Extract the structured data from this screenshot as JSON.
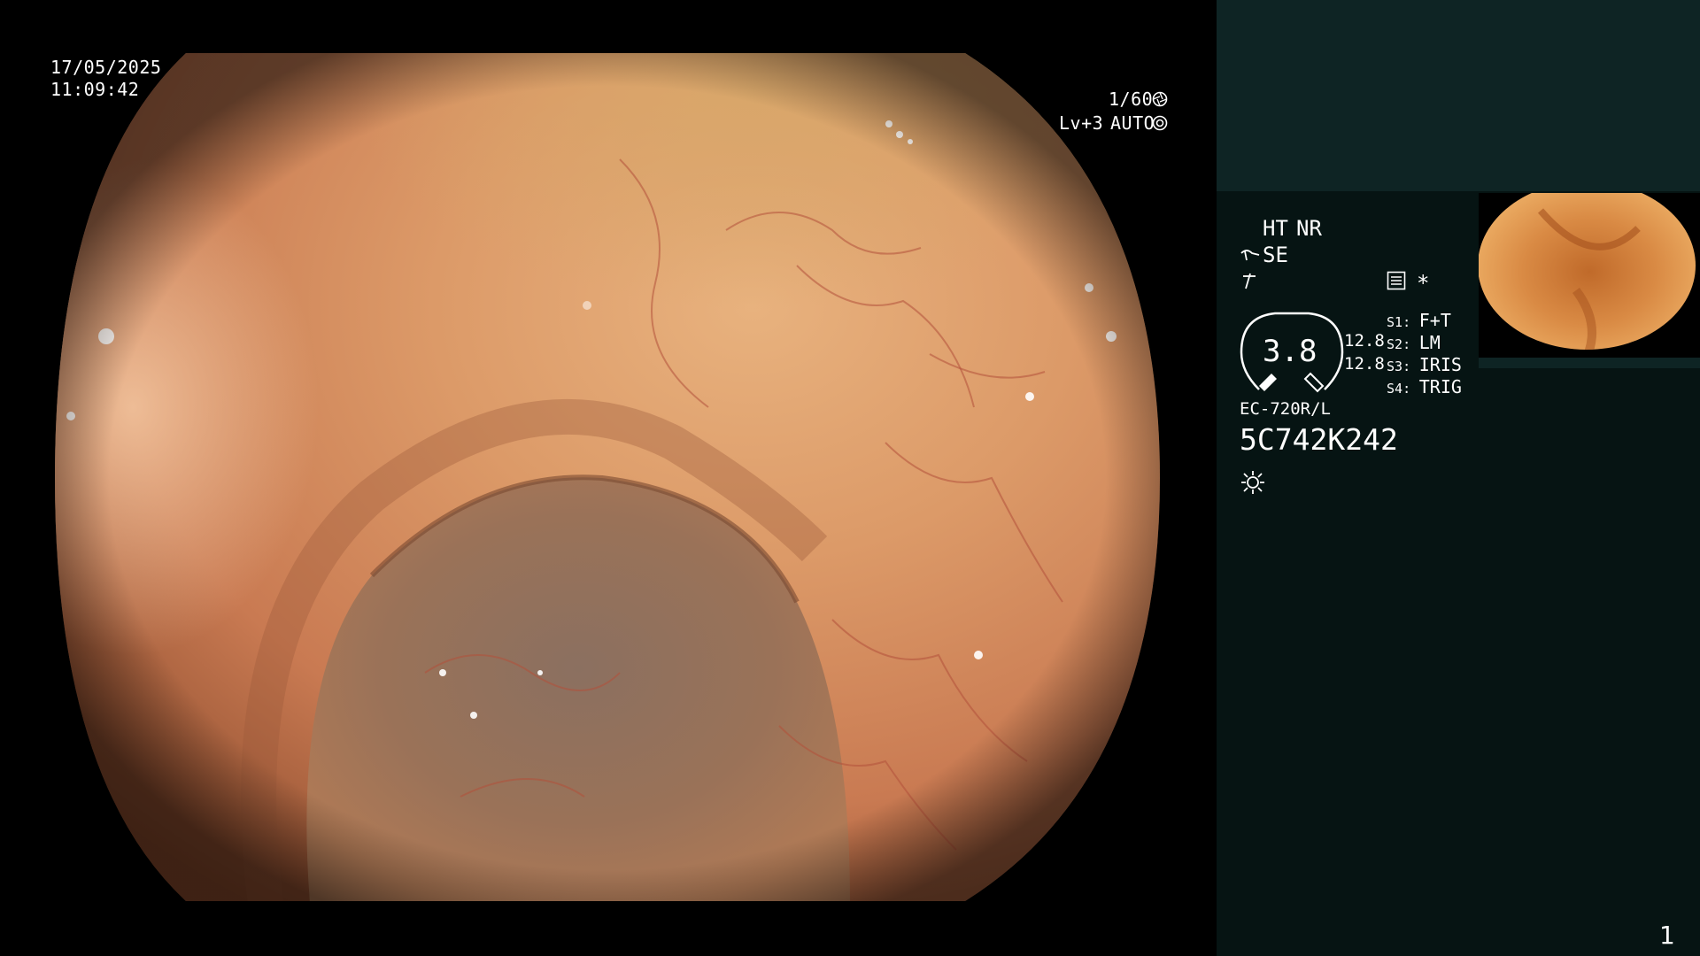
{
  "osd": {
    "date": "17/05/2025",
    "time": "11:09:42",
    "shutter": "1/60",
    "shutter_icon": "aperture-icon",
    "level": "Lv+3",
    "mode": "AUTO",
    "mode_icon": "iris-icon"
  },
  "panel": {
    "ht": "HT",
    "nr": "NR",
    "se": "SE",
    "gauge_value": "3.8",
    "gauge_left": "12.8",
    "gauge_right": "12.8",
    "switches": [
      {
        "key": "S1",
        "value": "F+T"
      },
      {
        "key": "S2",
        "value": "LM"
      },
      {
        "key": "S3",
        "value": "IRIS"
      },
      {
        "key": "S4",
        "value": "TRIG"
      }
    ],
    "asterisk": "*",
    "scope_model": "EC-720R/L",
    "serial": "5C742K242",
    "page": "1"
  },
  "colors": {
    "panel_bg": "#061413",
    "panel_top": "#0e2424",
    "accent_orange": "#f3a52a",
    "mucosa": "#d98c5a"
  },
  "icons": [
    "aperture-icon",
    "iris-icon",
    "scope-icon",
    "edge-enhance-icon",
    "recorder-icon",
    "light-icon"
  ]
}
